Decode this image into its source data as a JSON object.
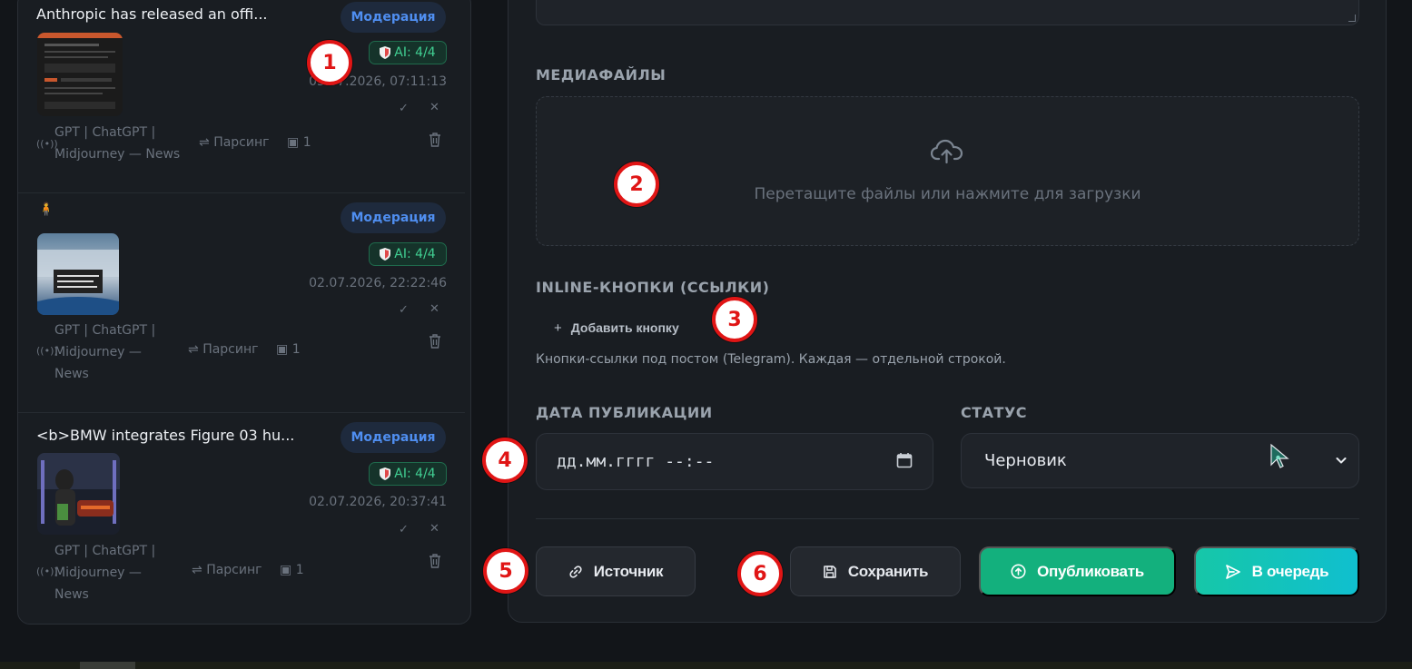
{
  "posts": [
    {
      "title": "Anthropic has released an offi...",
      "status_badge": "Модерация",
      "ai_badge": "AI: 4/4",
      "date": "03.07.2026, 07:11:13",
      "source_line1": "GPT | ChatGPT |",
      "source_line2": "Midjourney — News",
      "parse_label": "Парсинг",
      "media_count": "1"
    },
    {
      "title": "",
      "status_badge": "Модерация",
      "ai_badge": "AI: 4/4",
      "date": "02.07.2026, 22:22:46",
      "source_line1": "GPT | ChatGPT |",
      "source_line2": "Midjourney —",
      "source_line3": "News",
      "parse_label": "Парсинг",
      "media_count": "1"
    },
    {
      "title": "<b>BMW integrates Figure 03 hu...",
      "status_badge": "Модерация",
      "ai_badge": "AI: 4/4",
      "date": "02.07.2026, 20:37:41",
      "source_line1": "GPT | ChatGPT |",
      "source_line2": "Midjourney —",
      "source_line3": "News",
      "parse_label": "Парсинг",
      "media_count": "1"
    }
  ],
  "editor": {
    "media_label": "МЕДИАФАЙЛЫ",
    "dropzone_hint": "Перетащите файлы или нажмите для загрузки",
    "inline_label": "INLINE-КНОПКИ (ССЫЛКИ)",
    "add_button": "Добавить кнопку",
    "inline_help": "Кнопки-ссылки под постом (Telegram). Каждая — отдельной строкой.",
    "date_label": "ДАТА ПУБЛИКАЦИИ",
    "date_placeholder": "дд.мм.гггг --:--",
    "status_label": "СТАТУС",
    "status_value": "Черновик",
    "source_button": "Источник",
    "save_button": "Сохранить",
    "publish_button": "Опубликовать",
    "queue_button": "В очередь"
  },
  "callouts": [
    "1",
    "2",
    "3",
    "4",
    "5",
    "6"
  ],
  "colors": {
    "moderation": "#4f8ef0",
    "ai_ok": "#41d093",
    "publish": "#13b07d",
    "queue": "#10bfcf",
    "callout": "#e01515"
  }
}
